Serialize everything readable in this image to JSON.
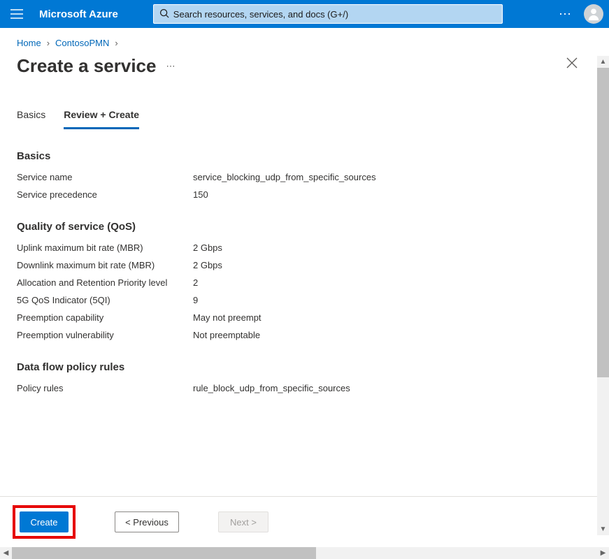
{
  "header": {
    "brand": "Microsoft Azure",
    "search_placeholder": "Search resources, services, and docs (G+/)"
  },
  "breadcrumb": {
    "home": "Home",
    "item1": "ContosoPMN"
  },
  "page": {
    "title": "Create a service"
  },
  "tabs": {
    "basics": "Basics",
    "review": "Review + Create"
  },
  "sections": {
    "basics": {
      "heading": "Basics",
      "service_name_label": "Service name",
      "service_name_value": "service_blocking_udp_from_specific_sources",
      "precedence_label": "Service precedence",
      "precedence_value": "150"
    },
    "qos": {
      "heading": "Quality of service (QoS)",
      "uplink_label": "Uplink maximum bit rate (MBR)",
      "uplink_value": "2 Gbps",
      "downlink_label": "Downlink maximum bit rate (MBR)",
      "downlink_value": "2 Gbps",
      "arp_label": "Allocation and Retention Priority level",
      "arp_value": "2",
      "fiveqi_label": "5G QoS Indicator (5QI)",
      "fiveqi_value": "9",
      "preempt_cap_label": "Preemption capability",
      "preempt_cap_value": "May not preempt",
      "preempt_vul_label": "Preemption vulnerability",
      "preempt_vul_value": "Not preemptable"
    },
    "dfpr": {
      "heading": "Data flow policy rules",
      "policy_label": "Policy rules",
      "policy_value": "rule_block_udp_from_specific_sources"
    }
  },
  "footer": {
    "create": "Create",
    "previous": "< Previous",
    "next": "Next >"
  }
}
